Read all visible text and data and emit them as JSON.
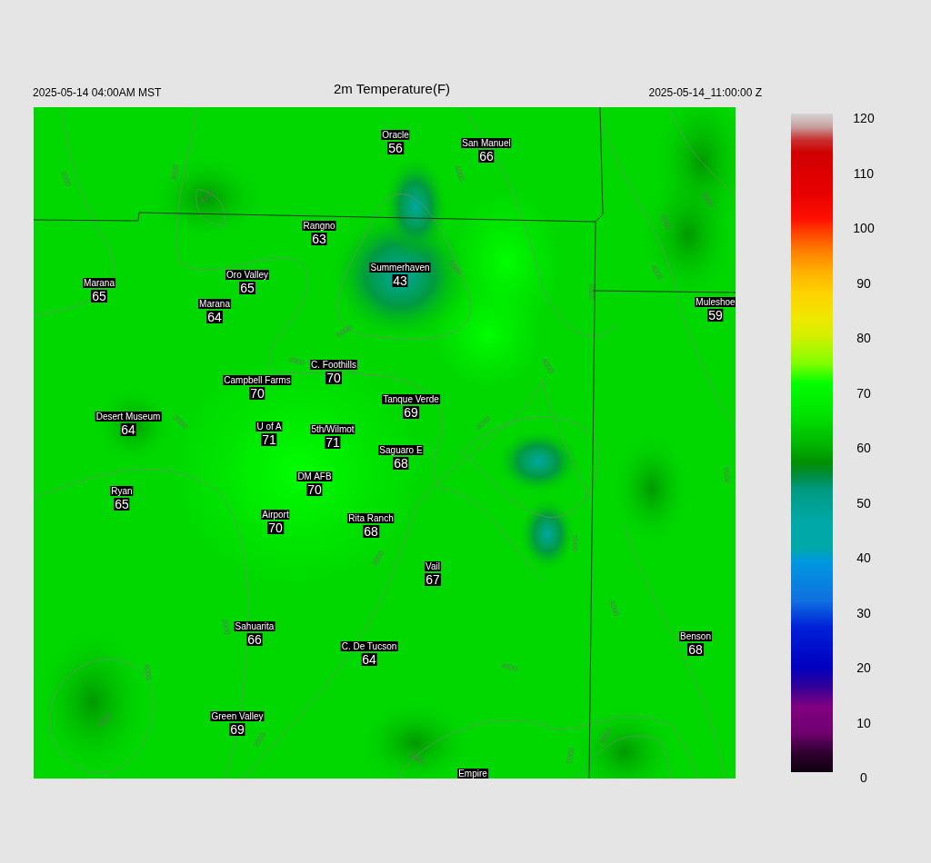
{
  "header": {
    "valid_time_local": "2025-05-14 04:00AM MST",
    "title": "2m Temperature(F)",
    "valid_time_utc": "2025-05-14_11:00:00 Z"
  },
  "stations": [
    {
      "name": "Oracle",
      "value": "56"
    },
    {
      "name": "San Manuel",
      "value": "66"
    },
    {
      "name": "Rangno",
      "value": "63"
    },
    {
      "name": "Summerhaven",
      "value": "43"
    },
    {
      "name": "Marana",
      "value": "65"
    },
    {
      "name": "Oro Valley",
      "value": "65"
    },
    {
      "name": "Marana",
      "value": "64"
    },
    {
      "name": "Muleshoe",
      "value": "59"
    },
    {
      "name": "C. Foothills",
      "value": "70"
    },
    {
      "name": "Campbell Farms",
      "value": "70"
    },
    {
      "name": "Tanque Verde",
      "value": "69"
    },
    {
      "name": "Desert Museum",
      "value": "64"
    },
    {
      "name": "U of A",
      "value": "71"
    },
    {
      "name": "5th/Wilmot",
      "value": "71"
    },
    {
      "name": "Saguaro E",
      "value": "68"
    },
    {
      "name": "DM AFB",
      "value": "70"
    },
    {
      "name": "Ryan",
      "value": "65"
    },
    {
      "name": "Airport",
      "value": "70"
    },
    {
      "name": "Rita Ranch",
      "value": "68"
    },
    {
      "name": "Vail",
      "value": "67"
    },
    {
      "name": "Sahuarita",
      "value": "66"
    },
    {
      "name": "C. De Tucson",
      "value": "64"
    },
    {
      "name": "Benson",
      "value": "68"
    },
    {
      "name": "Green Valley",
      "value": "69"
    },
    {
      "name": "Empire"
    }
  ],
  "contour_labels": [
    "2000",
    "3000",
    "4000",
    "4000",
    "6000",
    "3000",
    "3000",
    "5000",
    "3000",
    "4000",
    "4000",
    "5000",
    "6000",
    "4000",
    "3000",
    "3000",
    "4000",
    "5000",
    "3000",
    "5000",
    "4000",
    "4000",
    "4000",
    "5000",
    "6000",
    "5000"
  ],
  "color_scale": {
    "ticks": [
      "120",
      "110",
      "100",
      "90",
      "80",
      "70",
      "60",
      "50",
      "40",
      "30",
      "20",
      "10",
      "0"
    ]
  }
}
